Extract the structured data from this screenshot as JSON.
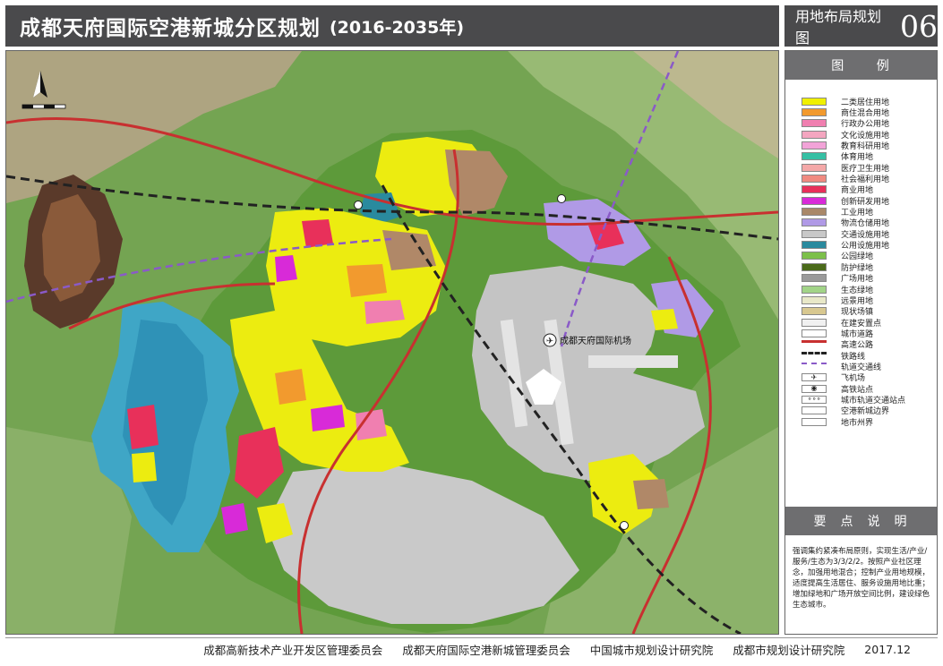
{
  "header": {
    "title": "成都天府国际空港新城分区规划",
    "years": "(2016-2035年)",
    "map_name": "用地布局规划图",
    "map_number": "06"
  },
  "legend": {
    "title": "图  例",
    "items": [
      {
        "label": "二类居住用地",
        "color": "#f0f000"
      },
      {
        "label": "商住混合用地",
        "color": "#f29a2e"
      },
      {
        "label": "行政办公用地",
        "color": "#f07fb0"
      },
      {
        "label": "文化设施用地",
        "color": "#f4a6c0"
      },
      {
        "label": "教育科研用地",
        "color": "#f2a3d8"
      },
      {
        "label": "体育用地",
        "color": "#36c0a4"
      },
      {
        "label": "医疗卫生用地",
        "color": "#f4a8a8"
      },
      {
        "label": "社会福利用地",
        "color": "#f08a80"
      },
      {
        "label": "商业用地",
        "color": "#e8305a"
      },
      {
        "label": "创新研发用地",
        "color": "#d82ad8"
      },
      {
        "label": "工业用地",
        "color": "#a98868"
      },
      {
        "label": "物流仓储用地",
        "color": "#b09ae6"
      },
      {
        "label": "交通设施用地",
        "color": "#c8c8c8"
      },
      {
        "label": "公用设施用地",
        "color": "#2a8a9e"
      },
      {
        "label": "公园绿地",
        "color": "#7cc04a"
      },
      {
        "label": "防护绿地",
        "color": "#4a6a1a"
      },
      {
        "label": "广场用地",
        "color": "#9a9a9a"
      },
      {
        "label": "生态绿地",
        "color": "#a2d488"
      },
      {
        "label": "远景用地",
        "color": "#e8e8c8"
      },
      {
        "label": "现状场镇",
        "color": "#d8c890"
      },
      {
        "label": "在建安置点",
        "color": "#f0f0f0"
      },
      {
        "label": "城市道路",
        "color": "#ffffff"
      },
      {
        "label": "高速公路",
        "color": "#c83030"
      },
      {
        "label": "铁路线",
        "color": "#222222"
      },
      {
        "label": "轨道交通线",
        "color": "#8a5ac8"
      },
      {
        "label": "飞机场",
        "color": "#ffffff",
        "glyph": "✈"
      },
      {
        "label": "高铁站点",
        "color": "#ffffff",
        "glyph": "◉"
      },
      {
        "label": "城市轨道交通站点",
        "color": "#ffffff",
        "glyph": "∘∘∘"
      },
      {
        "label": "空港新城边界",
        "color": "#ffffff"
      },
      {
        "label": "地市州界",
        "color": "#ffffff"
      }
    ]
  },
  "keypoints": {
    "title": "要点说明",
    "text": "强调集约紧凑布局原则，实现生活/产业/服务/生态为3/3/2/2。按照产业社区理念，加强用地混合；控制产业用地规模，适度提高生活居住、服务设施用地比重；增加绿地和广场开放空间比例，建设绿色生态城市。"
  },
  "map": {
    "airport_label": "成都天府国际机场"
  },
  "footer": {
    "org1": "成都高新技术产业开发区管理委员会",
    "org2": "成都天府国际空港新城管理委员会",
    "org3": "中国城市规划设计研究院",
    "org4": "成都市规划设计研究院",
    "date": "2017.12"
  }
}
